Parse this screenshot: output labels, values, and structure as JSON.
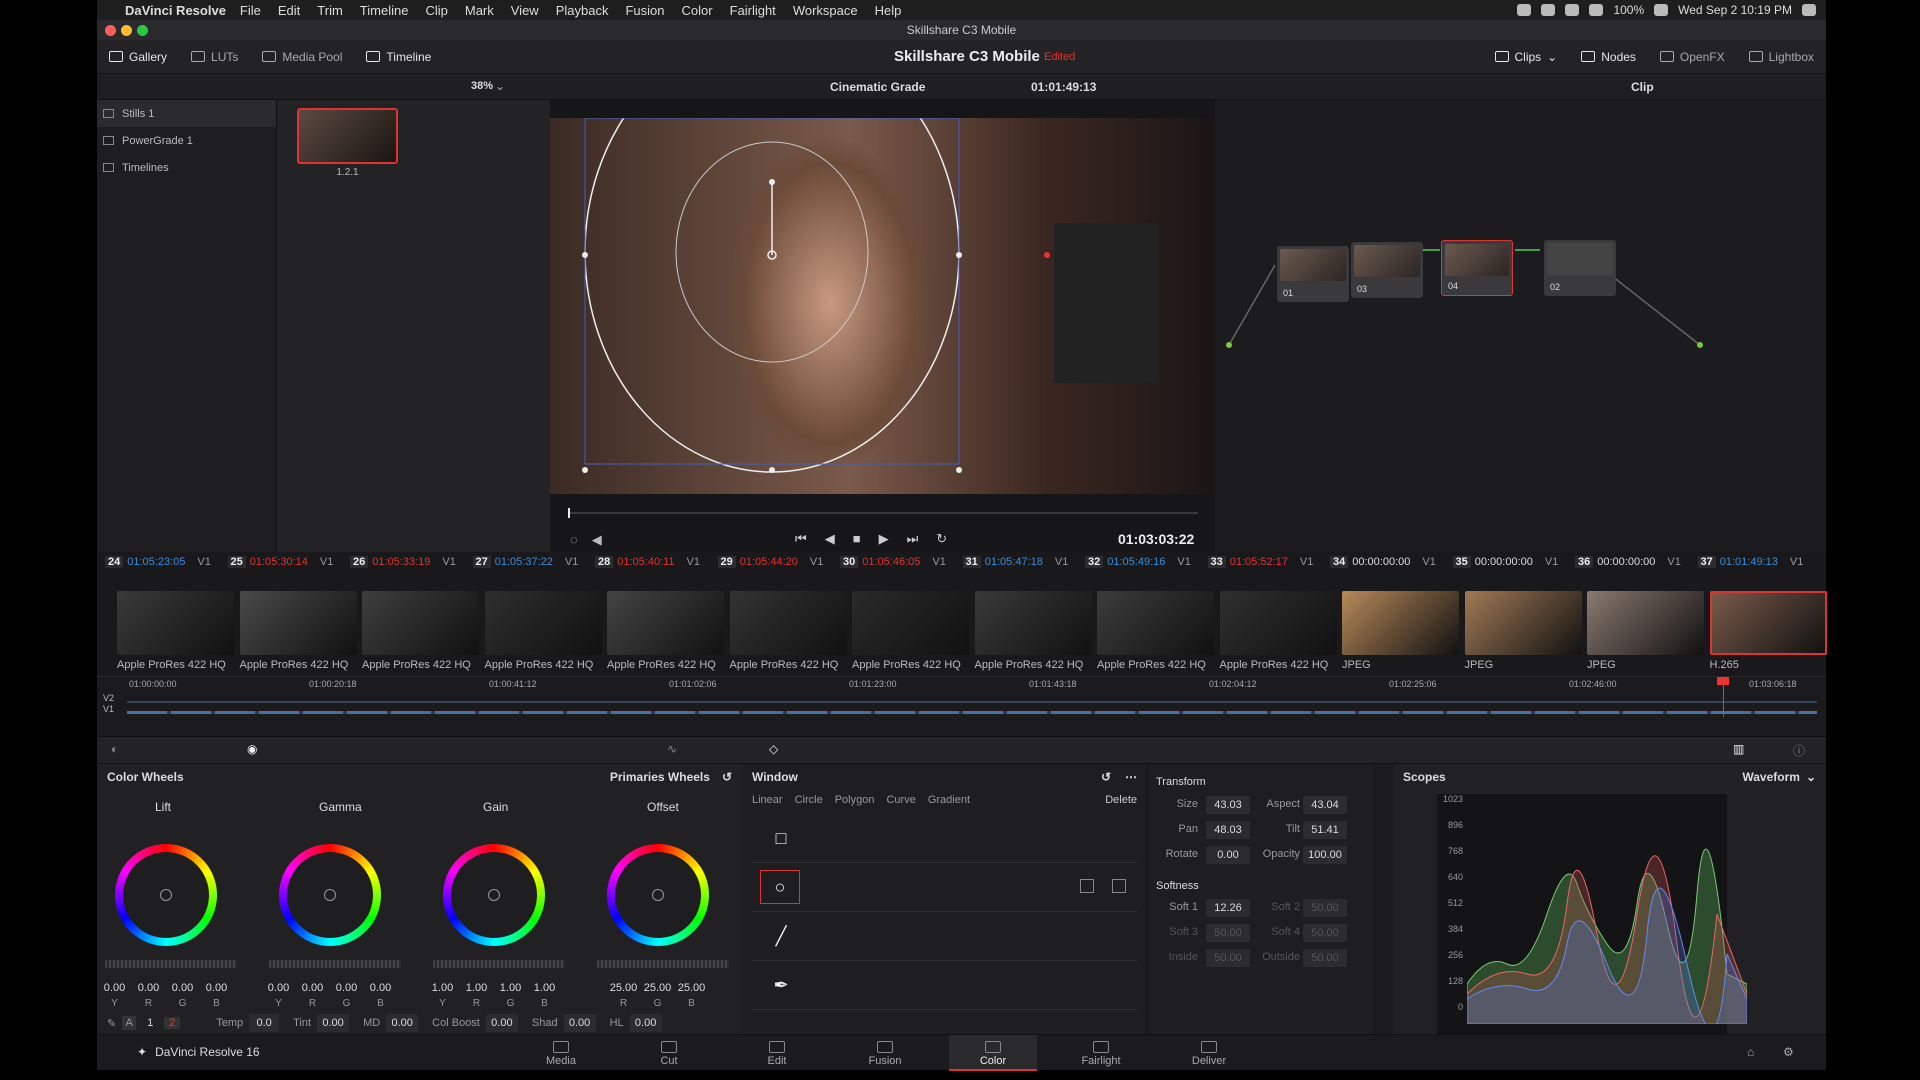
{
  "menubar": {
    "app": "DaVinci Resolve",
    "items": [
      "File",
      "Edit",
      "Trim",
      "Timeline",
      "Clip",
      "Mark",
      "View",
      "Playback",
      "Fusion",
      "Color",
      "Fairlight",
      "Workspace",
      "Help"
    ],
    "battery": "100%",
    "clock": "Wed Sep 2  10:19 PM"
  },
  "window": {
    "title": "Skillshare C3 Mobile",
    "project": "Skillshare C3 Mobile",
    "status": "Edited"
  },
  "topbar": {
    "gallery": "Gallery",
    "luts": "LUTs",
    "media_pool": "Media Pool",
    "timeline": "Timeline",
    "clips": "Clips",
    "nodes": "Nodes",
    "openfx": "OpenFX",
    "lightbox": "Lightbox"
  },
  "viewer": {
    "zoom": "38%",
    "grade_name": "Cinematic Grade",
    "timecode": "01:01:49:13",
    "playhead_tc": "01:03:03:22",
    "mode": "Clip"
  },
  "gallery": {
    "items": [
      "Stills 1",
      "PowerGrade 1",
      "Timelines"
    ],
    "still_label": "1.2.1"
  },
  "nodes": [
    {
      "label": "01"
    },
    {
      "label": "03"
    },
    {
      "label": "04"
    },
    {
      "label": "02"
    }
  ],
  "clips": [
    {
      "num": "24",
      "tc": "01:05:23:05",
      "track": "V1",
      "codec": "Apple ProRes 422 HQ",
      "tc_color": "#3a8ddb"
    },
    {
      "num": "25",
      "tc": "01:05:30:14",
      "track": "V1",
      "codec": "Apple ProRes 422 HQ",
      "tc_color": "#d33"
    },
    {
      "num": "26",
      "tc": "01:05:33:19",
      "track": "V1",
      "codec": "Apple ProRes 422 HQ",
      "tc_color": "#d33"
    },
    {
      "num": "27",
      "tc": "01:05:37:22",
      "track": "V1",
      "codec": "Apple ProRes 422 HQ",
      "tc_color": "#3a8ddb"
    },
    {
      "num": "28",
      "tc": "01:05:40:11",
      "track": "V1",
      "codec": "Apple ProRes 422 HQ",
      "tc_color": "#d33"
    },
    {
      "num": "29",
      "tc": "01:05:44:20",
      "track": "V1",
      "codec": "Apple ProRes 422 HQ",
      "tc_color": "#d33"
    },
    {
      "num": "30",
      "tc": "01:05:46:05",
      "track": "V1",
      "codec": "Apple ProRes 422 HQ",
      "tc_color": "#d33"
    },
    {
      "num": "31",
      "tc": "01:05:47:18",
      "track": "V1",
      "codec": "Apple ProRes 422 HQ",
      "tc_color": "#3a8ddb"
    },
    {
      "num": "32",
      "tc": "01:05:49:16",
      "track": "V1",
      "codec": "Apple ProRes 422 HQ",
      "tc_color": "#3a8ddb"
    },
    {
      "num": "33",
      "tc": "01:05:52:17",
      "track": "V1",
      "codec": "Apple ProRes 422 HQ",
      "tc_color": "#d33"
    },
    {
      "num": "34",
      "tc": "00:00:00:00",
      "track": "V1",
      "codec": "JPEG",
      "tc_color": "#ddd"
    },
    {
      "num": "35",
      "tc": "00:00:00:00",
      "track": "V1",
      "codec": "JPEG",
      "tc_color": "#ddd"
    },
    {
      "num": "36",
      "tc": "00:00:00:00",
      "track": "V1",
      "codec": "JPEG",
      "tc_color": "#ddd"
    },
    {
      "num": "37",
      "tc": "01:01:49:13",
      "track": "V1",
      "codec": "H.265",
      "tc_color": "#3a8ddb"
    }
  ],
  "ruler": {
    "ticks": [
      "01:00:00:00",
      "01:00:20:18",
      "01:00:41:12",
      "01:01:02:06",
      "01:01:23:00",
      "01:01:43:18",
      "01:02:04:12",
      "01:02:25:06",
      "01:02:46:00",
      "01:03:06:18"
    ],
    "tracks": [
      "V2",
      "V1"
    ]
  },
  "color_wheels": {
    "title": "Color Wheels",
    "mode": "Primaries Wheels",
    "wheels": [
      {
        "name": "Lift",
        "values": [
          "0.00",
          "0.00",
          "0.00",
          "0.00"
        ],
        "labels": [
          "Y",
          "R",
          "G",
          "B"
        ]
      },
      {
        "name": "Gamma",
        "values": [
          "0.00",
          "0.00",
          "0.00",
          "0.00"
        ],
        "labels": [
          "Y",
          "R",
          "G",
          "B"
        ]
      },
      {
        "name": "Gain",
        "values": [
          "1.00",
          "1.00",
          "1.00",
          "1.00"
        ],
        "labels": [
          "Y",
          "R",
          "G",
          "B"
        ]
      },
      {
        "name": "Offset",
        "values": [
          "25.00",
          "25.00",
          "25.00"
        ],
        "labels": [
          "R",
          "G",
          "B"
        ]
      }
    ],
    "bottom": {
      "page1": "1",
      "page2": "2",
      "temp_l": "Temp",
      "temp": "0.0",
      "tint_l": "Tint",
      "tint": "0.00",
      "md_l": "MD",
      "md": "0.00",
      "colboost_l": "Col Boost",
      "colboost": "0.00",
      "shad_l": "Shad",
      "shad": "0.00",
      "hl_l": "HL",
      "hl": "0.00"
    }
  },
  "window_panel": {
    "title": "Window",
    "tools": [
      "Linear",
      "Circle",
      "Polygon",
      "Curve",
      "Gradient"
    ],
    "delete": "Delete"
  },
  "transform": {
    "title": "Transform",
    "size_l": "Size",
    "size": "43.03",
    "aspect_l": "Aspect",
    "aspect": "43.04",
    "pan_l": "Pan",
    "pan": "48.03",
    "tilt_l": "Tilt",
    "tilt": "51.41",
    "rotate_l": "Rotate",
    "rotate": "0.00",
    "opacity_l": "Opacity",
    "opacity": "100.00",
    "softness_title": "Softness",
    "soft1_l": "Soft 1",
    "soft1": "12.26",
    "soft2_l": "Soft 2",
    "soft2": "50.00",
    "soft3_l": "Soft 3",
    "soft3": "50.00",
    "soft4_l": "Soft 4",
    "soft4": "50.00",
    "inside_l": "Inside",
    "inside": "50.00",
    "outside_l": "Outside",
    "outside": "50.00"
  },
  "scopes": {
    "title": "Scopes",
    "mode": "Waveform",
    "ticks": [
      "1023",
      "896",
      "768",
      "640",
      "512",
      "384",
      "256",
      "128",
      "0"
    ]
  },
  "pages": [
    "Media",
    "Cut",
    "Edit",
    "Fusion",
    "Color",
    "Fairlight",
    "Deliver"
  ],
  "footer": {
    "brand": "DaVinci Resolve 16"
  }
}
